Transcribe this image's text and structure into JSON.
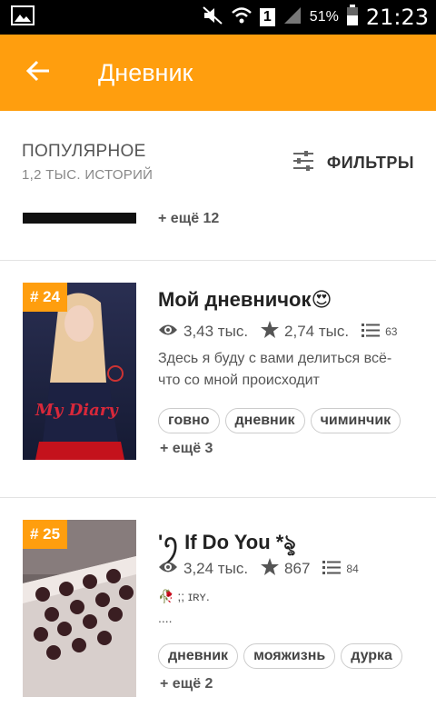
{
  "status_bar": {
    "battery": "51%",
    "time": "21:23",
    "sim": "1"
  },
  "app_bar": {
    "title": "Дневник"
  },
  "list_header": {
    "title": "ПОПУЛЯРНОЕ",
    "subtitle": "1,2 ТЫС. ИСТОРИЙ",
    "filters_label": "ФИЛЬТРЫ"
  },
  "prev_item": {
    "more": "+ ещё 12"
  },
  "stories": [
    {
      "rank": "# 24",
      "title": "Мой дневничок",
      "title_emoji": "😍",
      "views": "3,43 тыс.",
      "votes": "2,74 тыс.",
      "parts": "63",
      "description": "Здесь я буду с вами делиться всё-что со мной происходит",
      "cover_text": "My Diary",
      "tags": [
        "говно",
        "дневник",
        "чиминчик"
      ],
      "more_tags": "+ ещё 3"
    },
    {
      "rank": "# 25",
      "title": "'ꪆ If Do You *ৡ",
      "views": "3,24 тыс.",
      "votes": "867",
      "parts": "84",
      "description": "🥀 ;;  ɪʀʏ.",
      "description2": "....",
      "tags": [
        "дневник",
        "мояжизнь",
        "дурка"
      ],
      "more_tags": "+ ещё 2"
    }
  ],
  "colors": {
    "accent": "#ff9e0e",
    "status_bar": "#000000"
  }
}
